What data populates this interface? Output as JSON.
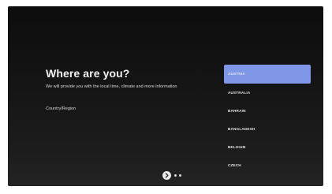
{
  "screen": {
    "title": "Where are you?",
    "description": "We will provide you with the local time, climate and more information",
    "region_label": "Country/Region"
  },
  "country_list": {
    "items": [
      {
        "label": "AUSTRIA",
        "selected": true
      },
      {
        "label": "AUSTRALIA",
        "selected": false
      },
      {
        "label": "BAHRAIN",
        "selected": false
      },
      {
        "label": "BANGLADESH",
        "selected": false
      },
      {
        "label": "BELGIUM",
        "selected": false
      },
      {
        "label": "CZECH",
        "selected": false
      }
    ]
  },
  "navigation": {
    "next_icon": "chevron-right-icon",
    "page_dots": 2
  },
  "colors": {
    "background": "#141414",
    "selected_item": "#7f97e6",
    "text": "#f2f2f2"
  }
}
